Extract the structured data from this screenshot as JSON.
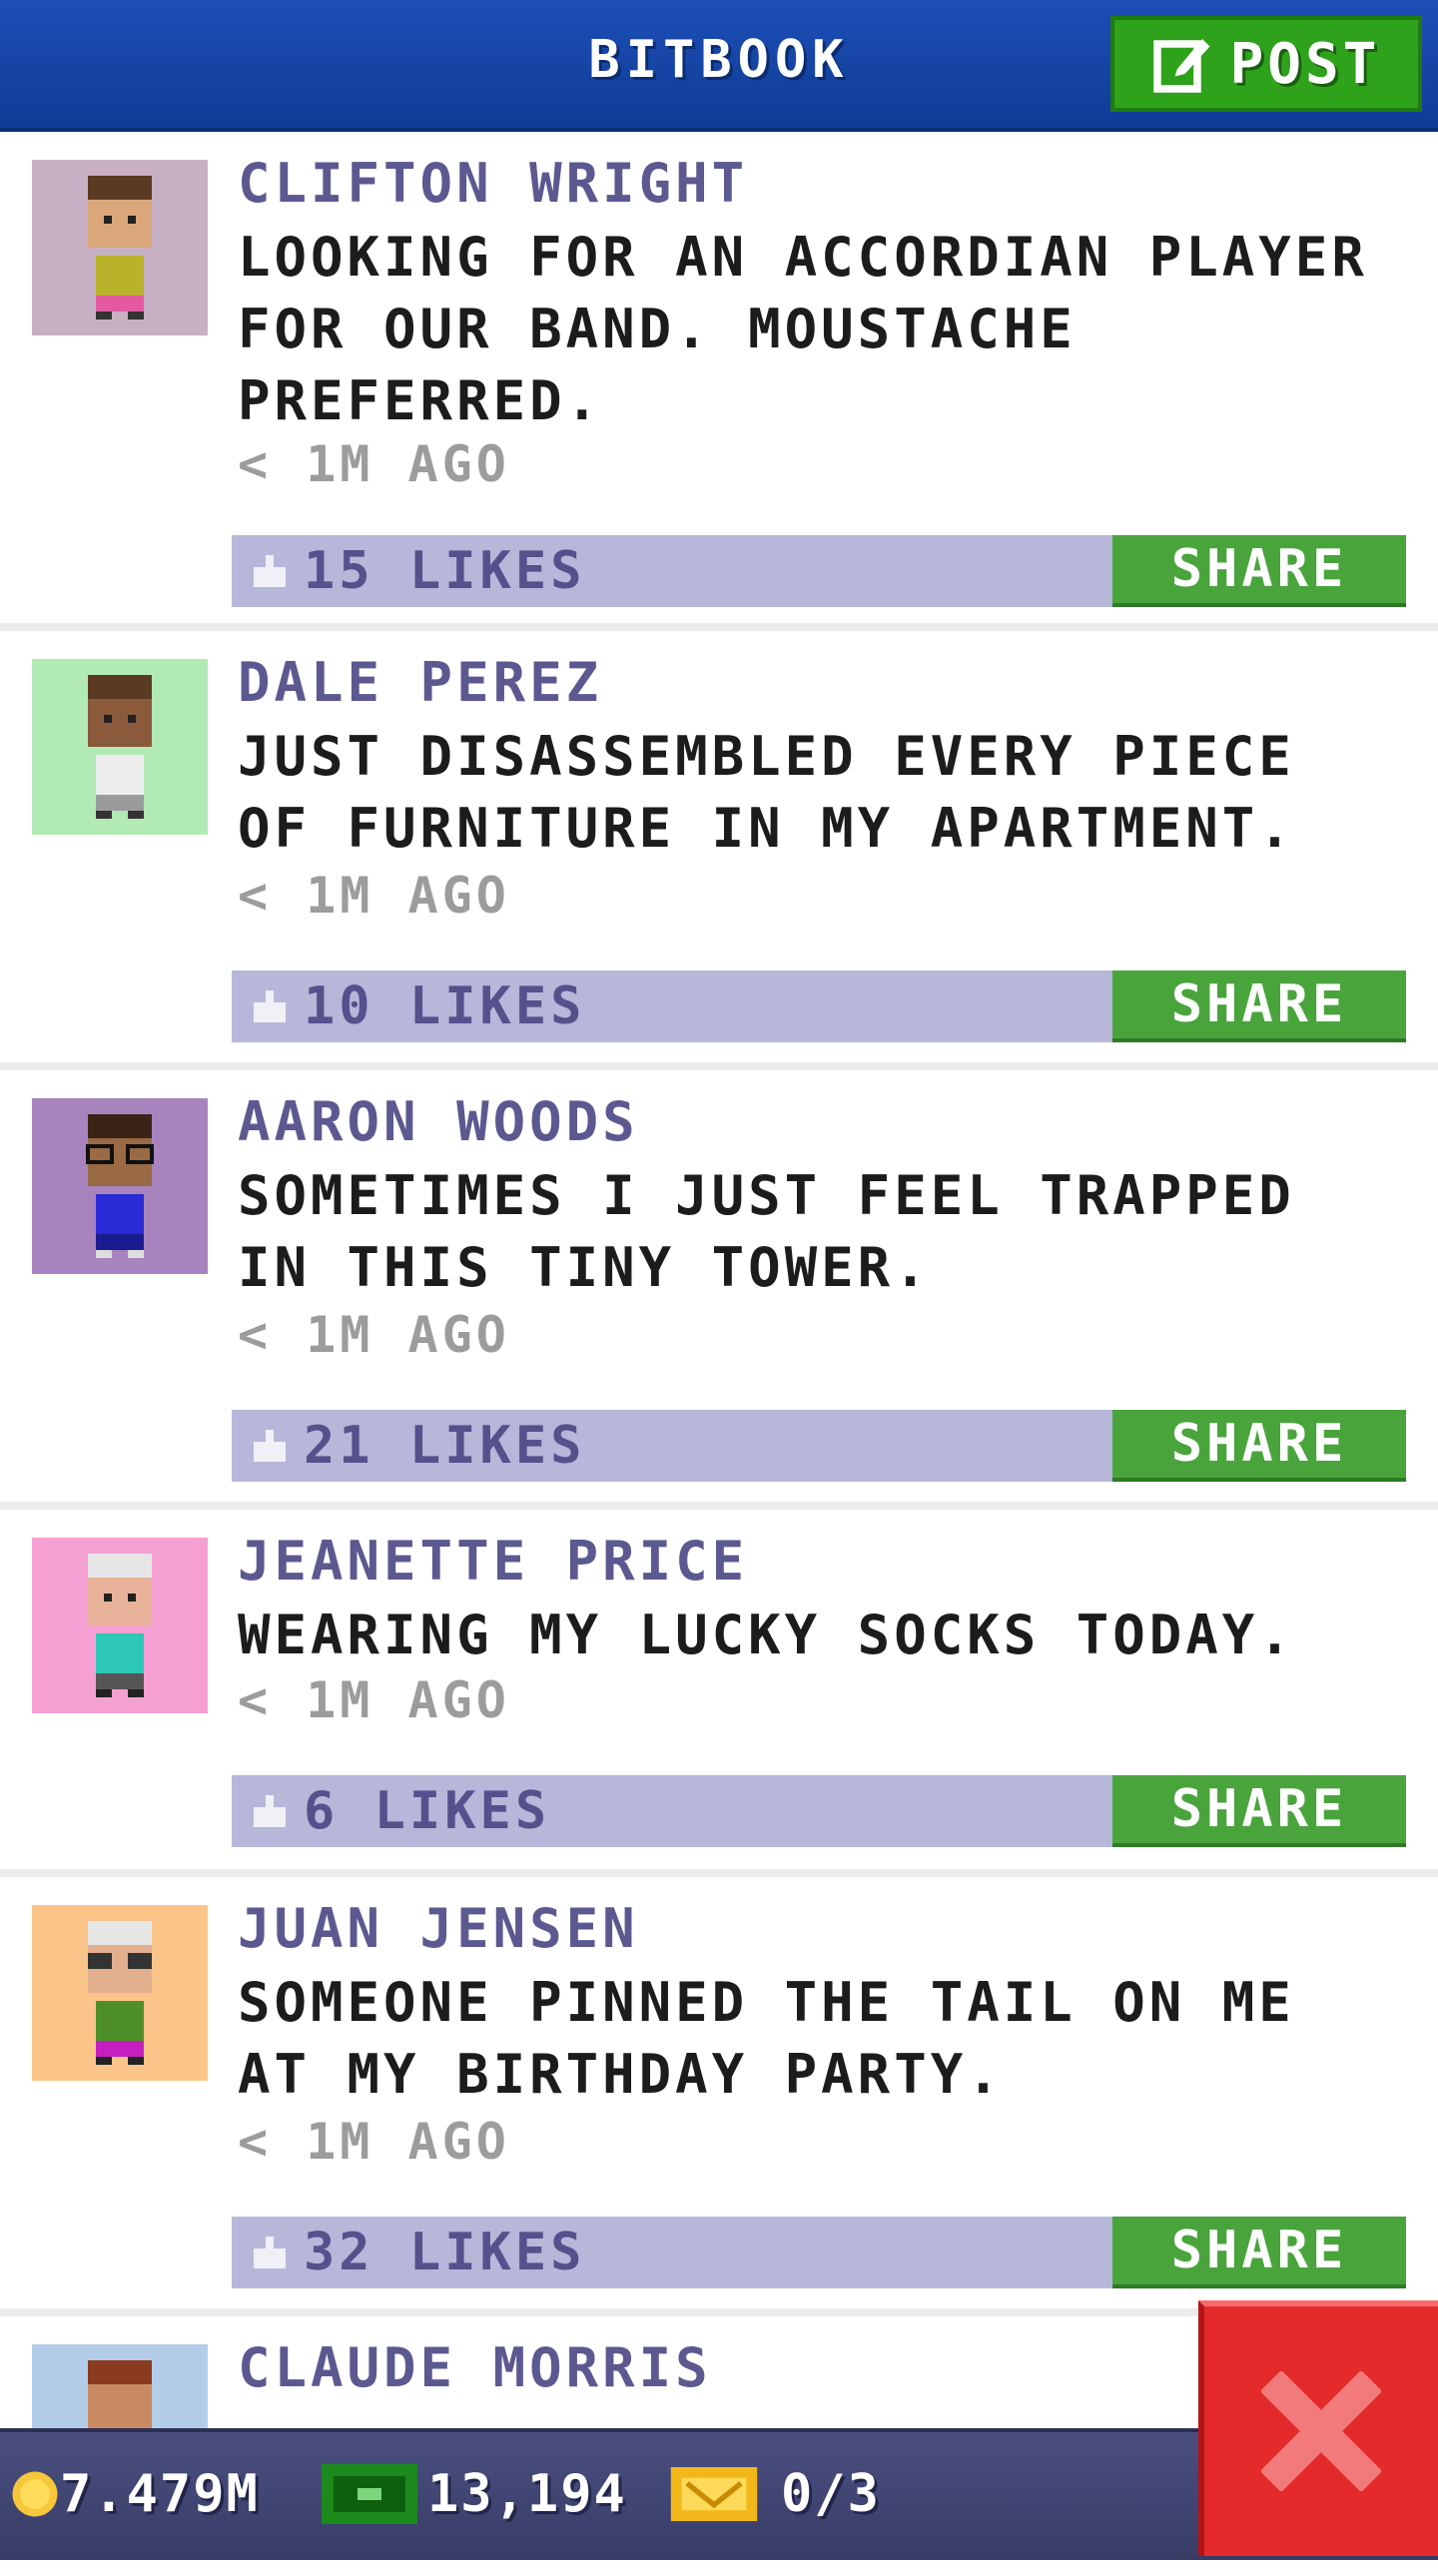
{
  "header": {
    "title": "BITBOOK",
    "post_label": "POST"
  },
  "posts": [
    {
      "author": "CLIFTON WRIGHT",
      "message": "LOOKING FOR AN ACCORDIAN PLAYER FOR OUR BAND. MOUSTACHE PREFERRED.",
      "time": "< 1M AGO",
      "likes": "15 LIKES",
      "share": "SHARE",
      "avatar_bg": "#c7b0c3"
    },
    {
      "author": "DALE PEREZ",
      "message": "JUST DISASSEMBLED EVERY PIECE OF FURNITURE IN MY APARTMENT.",
      "time": "< 1M AGO",
      "likes": "10 LIKES",
      "share": "SHARE",
      "avatar_bg": "#b2eab5"
    },
    {
      "author": "AARON WOODS",
      "message": "SOMETIMES I JUST FEEL TRAPPED IN THIS TINY TOWER.",
      "time": "< 1M AGO",
      "likes": "21 LIKES",
      "share": "SHARE",
      "avatar_bg": "#a784bd"
    },
    {
      "author": "JEANETTE PRICE",
      "message": "WEARING MY LUCKY SOCKS TODAY.",
      "time": "< 1M AGO",
      "likes": "6 LIKES",
      "share": "SHARE",
      "avatar_bg": "#f5a0d3"
    },
    {
      "author": "JUAN JENSEN",
      "message": "SOMEONE PINNED THE TAIL ON ME AT MY BIRTHDAY PARTY.",
      "time": "< 1M AGO",
      "likes": "32 LIKES",
      "share": "SHARE",
      "avatar_bg": "#fbc58a"
    },
    {
      "author": "CLAUDE MORRIS",
      "avatar_bg": "#b3cde9"
    }
  ],
  "bottombar": {
    "coins": "7.479M",
    "bux": "13,194",
    "tickets": "0/3"
  },
  "colors": {
    "header_blue": "#1d4fb6",
    "post_green": "#2fa21b",
    "share_green": "#49a43c",
    "like_bar": "#b6b7d9",
    "author_purple": "#5c5890",
    "close_red": "#e42a2a"
  },
  "icons": {
    "post": "edit-icon",
    "like": "thumbs-up-icon",
    "coin": "coin-icon",
    "bux": "cash-icon",
    "ticket": "ticket-icon",
    "close": "close-icon"
  }
}
